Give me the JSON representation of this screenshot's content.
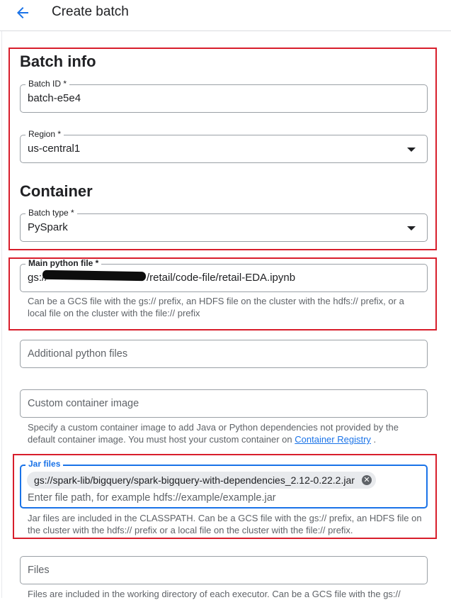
{
  "header": {
    "title": "Create batch"
  },
  "batch_info": {
    "title": "Batch info",
    "batch_id": {
      "label": "Batch ID *",
      "value": "batch-e5e4"
    },
    "region": {
      "label": "Region *",
      "value": "us-central1"
    }
  },
  "container": {
    "title": "Container",
    "batch_type": {
      "label": "Batch type *",
      "value": "PySpark"
    },
    "main_python_file": {
      "label": "Main python file *",
      "value_prefix": "gs://",
      "value_suffix": "/retail/code-file/retail-EDA.ipynb",
      "helper": "Can be a GCS file with the gs:// prefix, an HDFS file on the cluster with the hdfs:// prefix, or a local file on the cluster with the file:// prefix"
    },
    "additional_python_files": {
      "placeholder": "Additional python files"
    },
    "custom_container_image": {
      "placeholder": "Custom container image",
      "helper_text": "Specify a custom container image to add Java or Python dependencies not provided by the default container image. You must host your custom container on",
      "helper_link": "Container Registry",
      "helper_end": "."
    },
    "jar_files": {
      "label": "Jar files",
      "chip": "gs://spark-lib/bigquery/spark-bigquery-with-dependencies_2.12-0.22.2.jar",
      "placeholder": "Enter file path, for example hdfs://example/example.jar",
      "helper": "Jar files are included in the CLASSPATH. Can be a GCS file with the gs:// prefix, an HDFS file on the cluster with the hdfs:// prefix or a local file on the cluster with the file:// prefix."
    },
    "files": {
      "placeholder": "Files",
      "helper": "Files are included in the working directory of each executor. Can be a GCS file with the gs://"
    }
  },
  "colors": {
    "accent": "#1a73e8",
    "highlight": "#d81e2c"
  },
  "icons": {
    "back": "arrow-back-icon",
    "dropdown": "dropdown-arrow-icon",
    "chip_remove": "cancel-icon"
  }
}
